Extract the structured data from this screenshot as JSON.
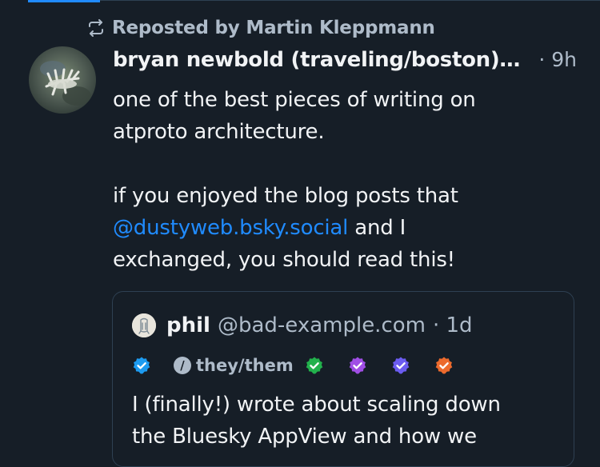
{
  "repost": {
    "text": "Reposted by Martin Kleppmann",
    "icon": "repost-icon"
  },
  "post": {
    "author": "bryan newbold (traveling/boston)…",
    "time": "· 9h",
    "lines": {
      "l1": "one of the best pieces of writing on",
      "l2": "atproto architecture.",
      "l3": "if you enjoyed the blog posts that",
      "mention": "@dustyweb.bsky.social",
      "l4_tail": " and I",
      "l5": "exchanged, you should read this!"
    }
  },
  "quote": {
    "name": "phil",
    "handle": "@bad-example.com",
    "time": "· 1d",
    "pronoun": "they/them",
    "pronoun_icon_glyph": "/",
    "badges": [
      {
        "icon": "verified-badge-icon",
        "color": "#1d9bf0"
      },
      {
        "icon": "verified-badge-icon",
        "color": "#22b14c"
      },
      {
        "icon": "verified-badge-icon",
        "color": "#a04ee5"
      },
      {
        "icon": "verified-badge-icon",
        "color": "#6b5cf0"
      },
      {
        "icon": "verified-badge-icon",
        "color": "#ec6a2d"
      }
    ],
    "text_l1": "I (finally!) wrote about scaling down",
    "text_l2": "the Bluesky AppView and how we"
  },
  "colors": {
    "background": "#161e27",
    "text_primary": "#f1f3f5",
    "text_secondary": "#aebbc9",
    "link": "#208bfe",
    "border": "#2e4052"
  }
}
